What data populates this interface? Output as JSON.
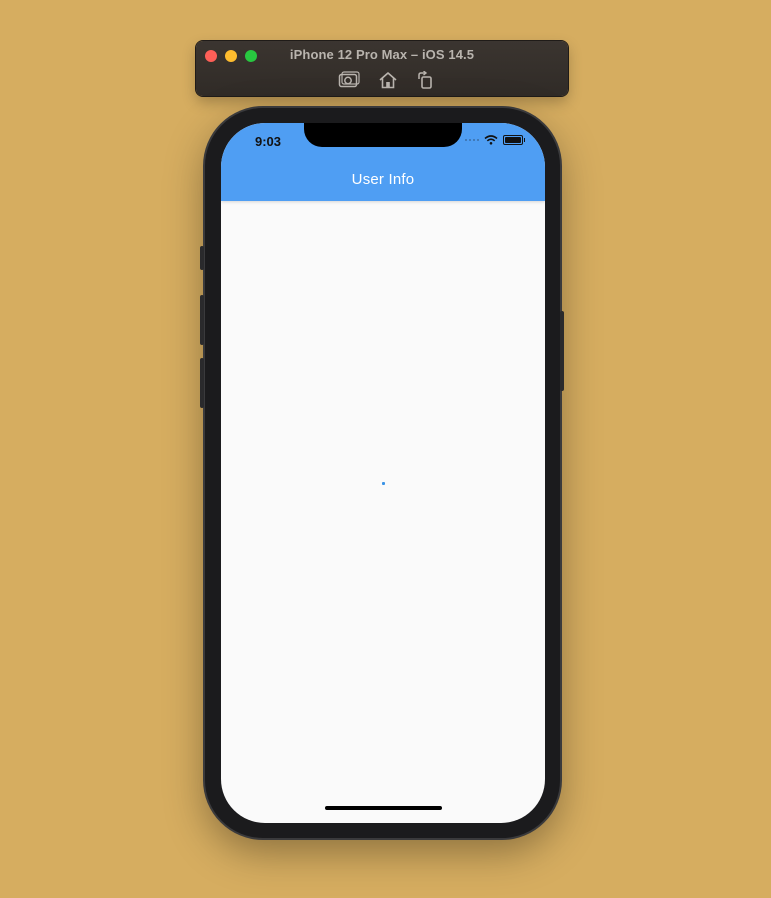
{
  "simulator": {
    "title": "iPhone 12 Pro Max – iOS 14.5",
    "window_controls": [
      "close",
      "minimize",
      "zoom"
    ],
    "toolbar_icons": [
      "screenshot-icon",
      "home-icon",
      "rotate-icon"
    ]
  },
  "device": {
    "status_bar": {
      "time": "9:03",
      "icons": [
        "cellular-signal-icon",
        "wifi-icon",
        "battery-icon"
      ]
    },
    "app_bar": {
      "title": "User Info",
      "color": "#4f9ef3"
    },
    "body": {
      "state": "loading",
      "indicator": "circular-progress",
      "indicator_color": "#3a93e6"
    }
  },
  "colors": {
    "desktop_background": "#d6ad60",
    "screen_background": "#fafafa"
  }
}
